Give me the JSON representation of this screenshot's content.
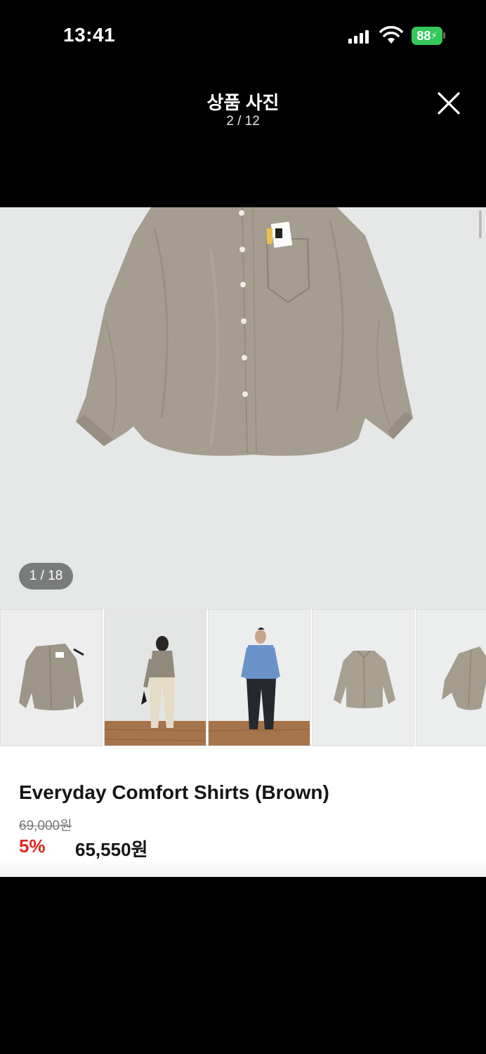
{
  "status_bar": {
    "time": "13:41",
    "battery": "88"
  },
  "header": {
    "title": "상품 사진",
    "counter": "2 / 12"
  },
  "gallery": {
    "photo_counter": "1 / 18",
    "thumbnails": [
      "shirt-flat",
      "model-khaki",
      "model-blue",
      "shirt-flat-front",
      "shirt-side"
    ]
  },
  "product": {
    "name": "Everyday Comfort Shirts (Brown)",
    "original_price": "69,000원",
    "discount": "5%",
    "sale_price": "65,550원"
  },
  "colors": {
    "background": "#000000",
    "discount_red": "#e0281e",
    "battery_green": "#34c759",
    "shirt_taupe": "#a59d90"
  }
}
